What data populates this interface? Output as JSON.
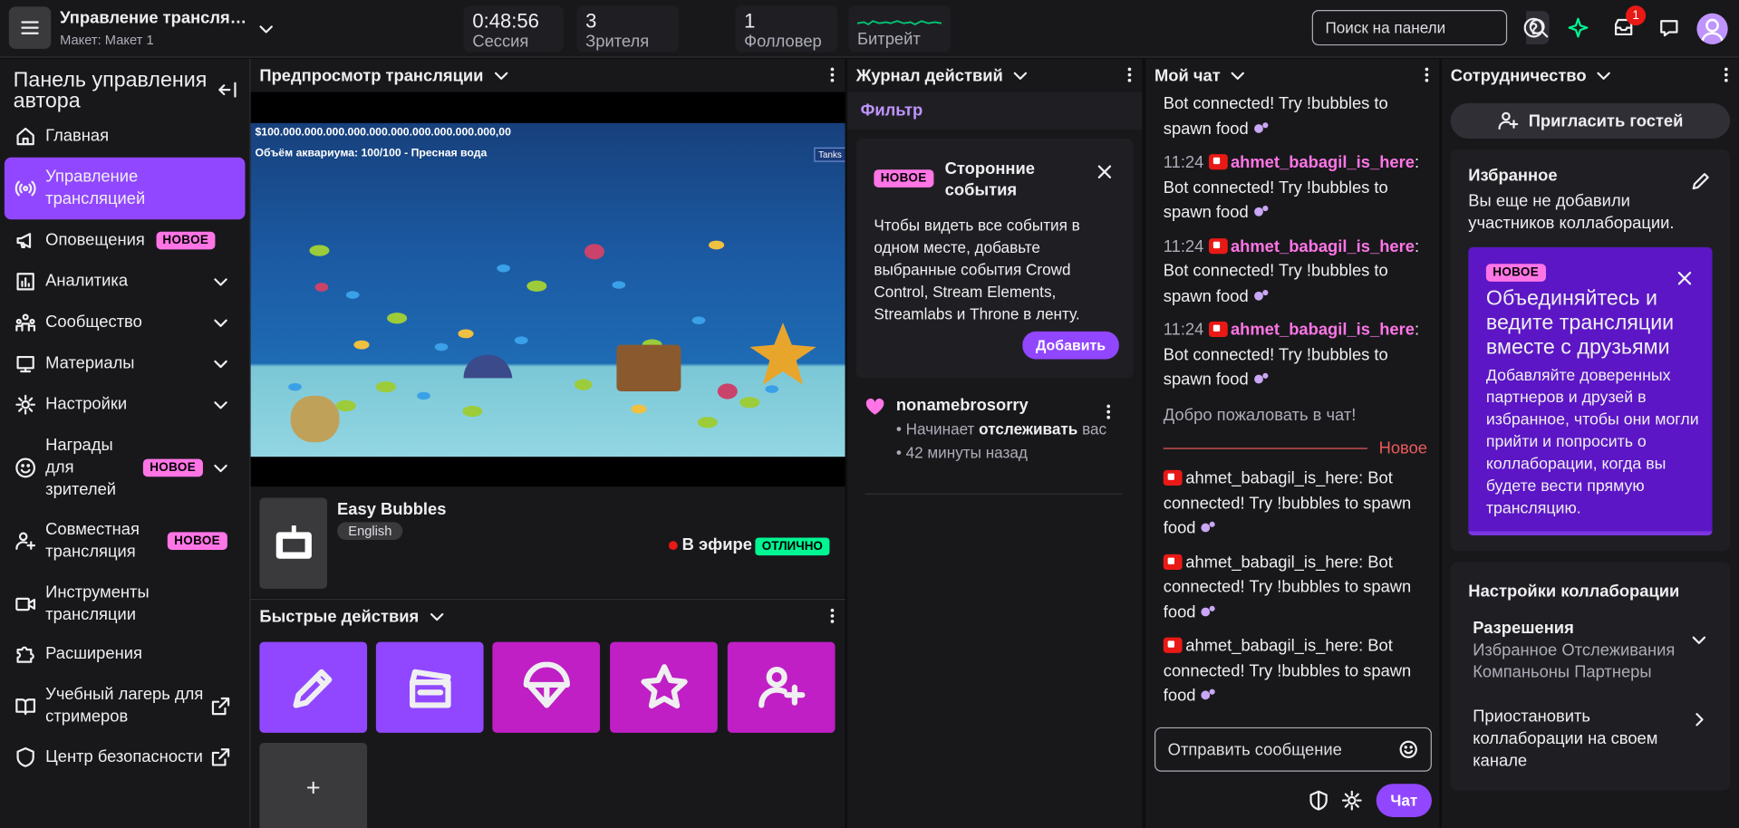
{
  "header": {
    "title": "Управление трансляцией",
    "layout": "Макет: Макет 1",
    "stats": [
      {
        "value": "0:48:56",
        "label": "Сессия"
      },
      {
        "value": "3",
        "label": "Зрителя"
      },
      {
        "value": "1",
        "label": "Фолловер"
      },
      {
        "value": "",
        "label": "Битрейт"
      }
    ],
    "search_placeholder": "Поиск на панели",
    "notifications_count": "1"
  },
  "sidebar": {
    "title": "Панель управления автора",
    "new_badge": "НОВОЕ",
    "items": [
      {
        "label": "Главная",
        "icon": "home-icon"
      },
      {
        "label": "Управление трансляцией",
        "icon": "broadcast-icon"
      },
      {
        "label": "Оповещения",
        "icon": "megaphone-icon"
      },
      {
        "label": "Аналитика",
        "icon": "analytics-icon"
      },
      {
        "label": "Сообщество",
        "icon": "community-icon"
      },
      {
        "label": "Материалы",
        "icon": "content-icon"
      },
      {
        "label": "Настройки",
        "icon": "settings-icon"
      },
      {
        "label": "Награды для зрителей",
        "icon": "rewards-icon"
      },
      {
        "label": "Совместная трансляция",
        "icon": "add-user-icon"
      },
      {
        "label": "Инструменты трансляции",
        "icon": "camera-icon"
      },
      {
        "label": "Расширения",
        "icon": "puzzle-icon"
      },
      {
        "label": "Учебный лагерь для стримеров",
        "icon": "book-icon"
      },
      {
        "label": "Центр безопасности",
        "icon": "shield-icon"
      }
    ]
  },
  "preview": {
    "title": "Предпросмотр трансляции",
    "money": "$100.000.000.000.000.000.000.000.000.000.000,00",
    "volume": "Объём аквариума: 100/100 - Пресная вода",
    "tanks": "Tanks",
    "game": "Easy Bubbles",
    "language": "English",
    "live": "В эфире",
    "health": "ОТЛИЧНО"
  },
  "quick_actions": {
    "title": "Быстрые действия",
    "add": "+",
    "colors": {
      "edit": "#9147ff",
      "clip": "#9147ff",
      "drop": "#bf1fc4",
      "star": "#bf1fc4",
      "raid": "#bf1fc4"
    }
  },
  "activity": {
    "title": "Журнал действий",
    "filter": "Фильтр",
    "card_badge": "НОВОЕ",
    "card_title": "Сторонние события",
    "card_text": "Чтобы видеть все события в одном месте, добавьте выбранные события Crowd Control, Stream Elements, Streamlabs и Throne в ленту.",
    "card_button": "Добавить",
    "event_user": "nonamebrosorry",
    "event_pre": " • Начинает ",
    "event_bold": "отслеживать",
    "event_post": " вас • 42 минуты назад"
  },
  "chat": {
    "title": "Мой чат",
    "user": "ahmet_babagil_is_here",
    "early": [
      {
        "time": "",
        "text": "Bot connected! Try !bubbles to spawn food"
      },
      {
        "time": "11:24",
        "text": "Bot connected! Try !bubbles to spawn food"
      },
      {
        "time": "11:24",
        "text": "Bot connected! Try !bubbles to spawn food"
      },
      {
        "time": "11:24",
        "text": "Bot connected! Try !bubbles to spawn food"
      }
    ],
    "welcome": "Добро пожаловать в чат!",
    "new_divider": "Новое",
    "late": [
      {
        "text": "Bot connected! Try !bubbles to spawn food"
      },
      {
        "text": "Bot connected! Try !bubbles to spawn food"
      },
      {
        "text": "Bot connected! Try !bubbles to spawn food"
      }
    ],
    "input_placeholder": "Отправить сообщение",
    "send": "Чат"
  },
  "collab": {
    "title": "Сотрудничество",
    "invite": "Пригласить гостей",
    "fav_title": "Избранное",
    "fav_text": "Вы еще не добавили участников коллаборации.",
    "promo_badge": "НОВОЕ",
    "promo_title": "Объединяйтесь и ведите трансляции вместе с друзьями",
    "promo_text": "Добавляйте доверенных партнеров и друзей в избранное, чтобы они могли прийти и попросить о коллаборации, когда вы будете вести прямую трансляцию.",
    "settings_title": "Настройки коллаборации",
    "perm_title": "Разрешения",
    "perm_value": "Избранное Отслеживания Компаньоны Партнеры",
    "pause": "Приостановить коллаборации на своем канале"
  },
  "colors": {
    "accent": "#9147ff",
    "new_badge": "#ff75e6",
    "live_ok": "#00f593"
  }
}
